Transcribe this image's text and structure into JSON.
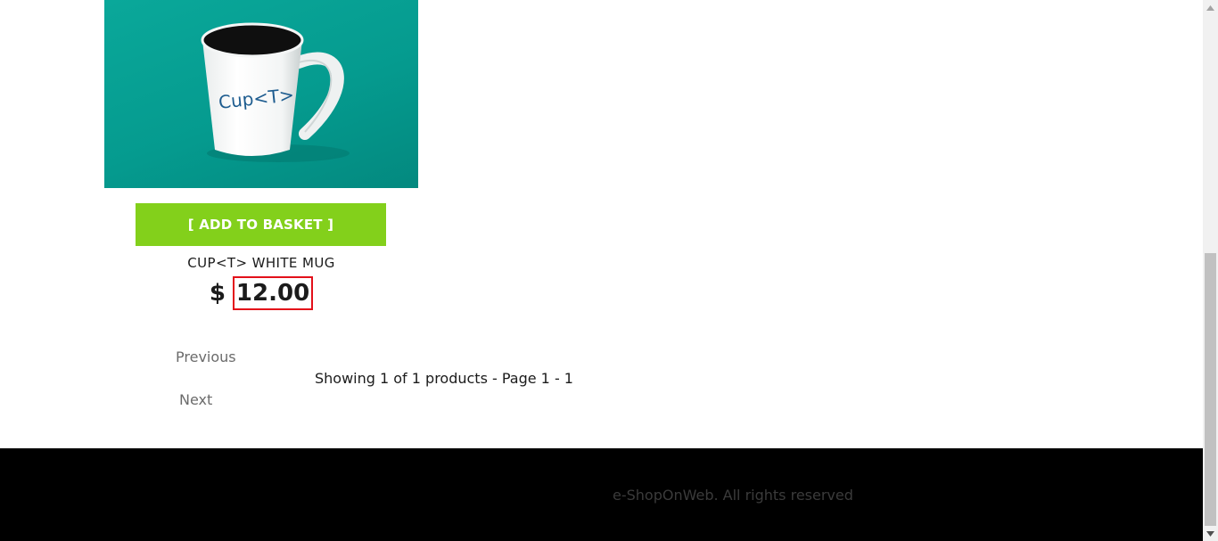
{
  "product": {
    "image_alt": "Cup<T> mug",
    "mug_logo_text": "Cup<T>",
    "add_to_basket_label": "[ ADD TO BASKET ]",
    "name": "CUP<T> WHITE MUG",
    "currency_symbol": "$",
    "price": "12.00"
  },
  "pager": {
    "previous_label": "Previous",
    "next_label": "Next",
    "info": "Showing 1 of 1 products - Page 1 - 1"
  },
  "footer": {
    "text": "e-ShopOnWeb. All rights reserved"
  },
  "colors": {
    "accent_button": "#83d01b",
    "image_background": "#059b8f",
    "highlight_border": "#e3101a",
    "footer_background": "#000000"
  },
  "icons": {
    "scroll_up": "scroll-up-arrow-icon",
    "scroll_down": "scroll-down-arrow-icon"
  }
}
